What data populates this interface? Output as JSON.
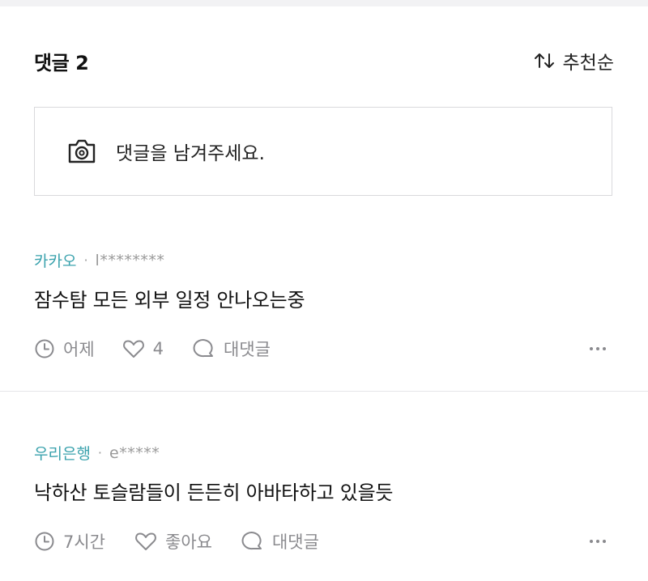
{
  "header": {
    "title": "댓글",
    "count": "2",
    "sort_label": "추천순"
  },
  "input": {
    "placeholder": "댓글을 남겨주세요."
  },
  "comments": [
    {
      "author": "카카오",
      "user": "l********",
      "text": "잠수탐 모든 외부 일정 안나오는중",
      "time": "어제",
      "likes": "4",
      "reply_label": "대댓글"
    },
    {
      "author": "우리은행",
      "user": "e*****",
      "text": "낙하산 토슬람들이 든든히 아바타하고 있을듯",
      "time": "7시간",
      "likes": "좋아요",
      "reply_label": "대댓글"
    }
  ],
  "colors": {
    "author": "#3aa2ad",
    "muted": "#8a8a8e",
    "border": "#d9d9dc"
  }
}
